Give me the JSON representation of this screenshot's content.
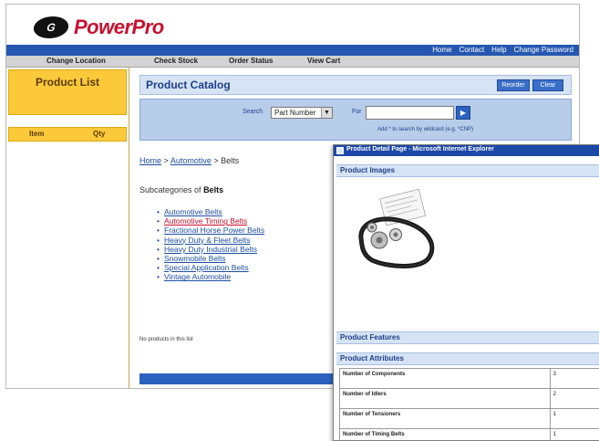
{
  "brand": {
    "logo_badge": "G",
    "name": "PowerPro"
  },
  "top_links": [
    "Home",
    "Contact",
    "Help",
    "Change Password"
  ],
  "nav": {
    "change_location": "Change Location",
    "check_stock": "Check Stock",
    "order_status": "Order Status",
    "view_cart": "View Cart"
  },
  "sidebar": {
    "title": "Product List",
    "col_item": "Item",
    "col_qty": "Qty"
  },
  "content": {
    "title": "Product Catalog",
    "btn_reorder": "Reorder",
    "btn_clear": "Clear",
    "search_label": "Search",
    "search_type": "Part Number",
    "for_label": "For",
    "search_value": "",
    "search_hint": "Add * to search by wildcard (e.g. *CNP)"
  },
  "breadcrumb": {
    "home": "Home",
    "sep": ">",
    "automotive": "Automotive",
    "current": "Belts"
  },
  "subcategory": {
    "prefix": "Subcategories of",
    "name": "Belts"
  },
  "categories": [
    "Automotive Belts",
    "Automotive Timing Belts",
    "Fractional Horse Power Belts",
    "Heavy Duty & Fleet Belts",
    "Heavy Duty Industrial Belts",
    "Snowmobile Belts",
    "Special Application Belts",
    "Vintage Automobile"
  ],
  "no_products": "No products in this list",
  "popup": {
    "title": "Product Detail Page - Microsoft Internet Explorer",
    "images_label": "Product Images",
    "features_label": "Product Features",
    "attributes_label": "Product Attributes",
    "attributes": [
      {
        "name": "Number of Components",
        "value": "3"
      },
      {
        "name": "Number of Idlers",
        "value": "2"
      },
      {
        "name": "Number of Tensioners",
        "value": "1"
      },
      {
        "name": "Number of Timing Belts",
        "value": "1"
      }
    ]
  },
  "colors": {
    "brand_red": "#c8102e",
    "top_bar_blue": "#2557b0",
    "sidebar_gold": "#fcc93a",
    "panel_blue": "#d6e3f4"
  }
}
